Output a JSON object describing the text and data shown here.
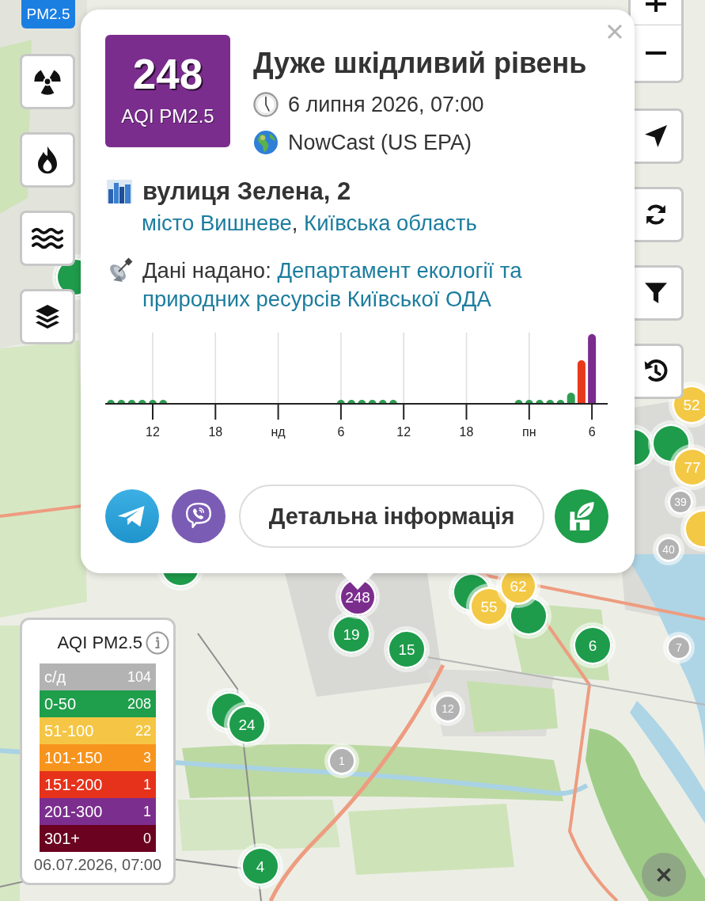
{
  "layers": [
    {
      "kind": "aqi",
      "label": "PM2.5",
      "selected": true
    },
    {
      "kind": "radiation",
      "selected": false
    },
    {
      "kind": "fire",
      "selected": false
    },
    {
      "kind": "water",
      "selected": false
    }
  ],
  "map_markers": [
    {
      "color": "#1e9c4b"
    },
    {
      "label": "52",
      "color": "#f3c845"
    },
    {
      "color": "#1e9c4b"
    },
    {
      "color": "#1e9c4b"
    },
    {
      "label": "77",
      "color": "#f3c845"
    },
    {
      "label": "39",
      "color": "#b2b2b2"
    },
    {
      "color": "#f3c845"
    },
    {
      "label": "40",
      "color": "#b2b2b2"
    },
    {
      "color": "#1e9c4b"
    },
    {
      "label": "248",
      "color": "#7b2d8e"
    },
    {
      "color": "#1e9c4b"
    },
    {
      "label": "55",
      "color": "#f3c845"
    },
    {
      "label": "62",
      "color": "#f3c845"
    },
    {
      "color": "#1e9c4b"
    },
    {
      "label": "19",
      "color": "#1e9c4b"
    },
    {
      "label": "15",
      "color": "#1e9c4b"
    },
    {
      "label": "6",
      "color": "#1e9c4b"
    },
    {
      "label": "7",
      "color": "#b2b2b2"
    },
    {
      "label": "12",
      "color": "#b2b2b2"
    },
    {
      "color": "#1e9c4b"
    },
    {
      "label": "24",
      "color": "#1e9c4b"
    },
    {
      "label": "1",
      "color": "#b2b2b2"
    },
    {
      "label": "4",
      "color": "#1e9c4b"
    }
  ],
  "popup": {
    "aqi": {
      "value": "248",
      "label": "AQI PM2.5",
      "color": "#7b2d8e"
    },
    "title": "Дуже шкідливий рівень",
    "time": "6 липня 2026, 07:00",
    "method": "NowCast (US EPA)",
    "address": "вулиця Зелена, 2",
    "city_link": "місто Вишневе",
    "separator": ",",
    "region_link": "Київська область",
    "source_label": "Дані надано:",
    "source_link_lines": [
      "Департамент екології та",
      "природних ресурсів Київської ОДА"
    ],
    "chart": {
      "axis_labels": [
        "12",
        "18",
        "нд",
        "6",
        "12",
        "18",
        "пн",
        "6"
      ]
    },
    "details_button": "Детальна інформація"
  },
  "legend": {
    "title": "AQI PM2.5",
    "rows": [
      {
        "range": "с/д",
        "count": "104",
        "color": "#b3b3b3"
      },
      {
        "range": "0-50",
        "count": "208",
        "color": "#1f9e4b"
      },
      {
        "range": "51-100",
        "count": "22",
        "color": "#f5c645"
      },
      {
        "range": "101-150",
        "count": "3",
        "color": "#f7941d"
      },
      {
        "range": "151-200",
        "count": "1",
        "color": "#e6321b"
      },
      {
        "range": "201-300",
        "count": "1",
        "color": "#7c2e8e"
      },
      {
        "range": "301+",
        "count": "0",
        "color": "#6a0220"
      }
    ],
    "updated": "06.07.2026, 07:00"
  }
}
